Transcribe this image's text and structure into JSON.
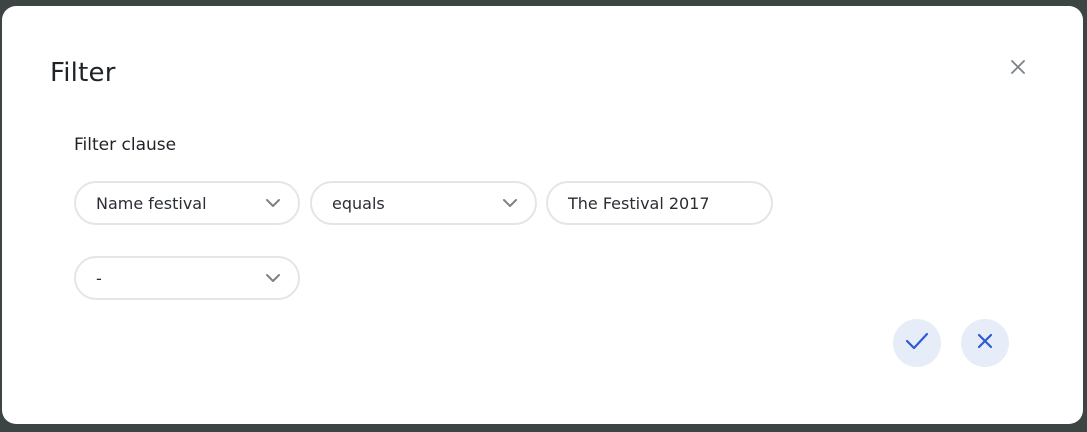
{
  "dialog": {
    "title": "Filter"
  },
  "filter": {
    "section_label": "Filter clause",
    "field": "Name festival",
    "operator": "equals",
    "value": "The Festival 2017",
    "logic": "-"
  },
  "icons": {
    "close": "close-icon",
    "chevron": "chevron-down-icon",
    "confirm": "check-icon",
    "cancel": "x-icon"
  },
  "colors": {
    "accent": "#2d5bd6",
    "button_bg": "#e6ecf8",
    "border": "#e3e5e8",
    "backdrop": "#3d4544"
  }
}
